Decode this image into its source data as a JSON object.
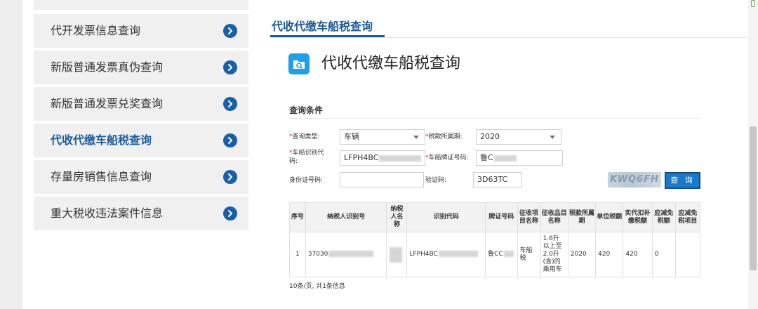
{
  "sidebar": {
    "items": [
      {
        "label": "",
        "active": false
      },
      {
        "label": "代开发票信息查询",
        "active": false
      },
      {
        "label": "新版普通发票真伪查询",
        "active": false
      },
      {
        "label": "新版普通发票兑奖查询",
        "active": false
      },
      {
        "label": "代收代缴车船税查询",
        "active": true
      },
      {
        "label": "存量房销售信息查询",
        "active": false
      },
      {
        "label": "重大税收违法案件信息",
        "active": false
      }
    ]
  },
  "tab": {
    "title": "代收代缴车船税查询"
  },
  "page": {
    "heading": "代收代缴车船税查询",
    "icon": "search-folder-icon"
  },
  "form": {
    "section_label": "查询条件",
    "query_type": {
      "label": "查询类型:",
      "value": "车辆"
    },
    "tax_period": {
      "label": "税款所属期:",
      "value": "2020"
    },
    "vin": {
      "label_line1": "车船识别代",
      "label_line2": "码:",
      "value": "LFPH4BC"
    },
    "plate": {
      "label": "车船牌证号码:",
      "value": "鲁C"
    },
    "id_number": {
      "label": "身份证号码:",
      "value": ""
    },
    "captcha": {
      "label": "验证码:",
      "value": "3D63TC",
      "image_text": "KWQ6FH"
    },
    "query_button": "查 询"
  },
  "table": {
    "headers": [
      "序号",
      "纳税人识别号",
      "纳税人名称",
      "识别代码",
      "牌证号码",
      "征收项目名称",
      "征收品目名称",
      "税款所属期",
      "单位税额",
      "实代扣补缴税额",
      "应减免税额",
      "应减免税项目"
    ],
    "rows": [
      [
        "1",
        "37030",
        "",
        "LFPH4BC",
        "鲁CC",
        "车船税",
        "1.6升以上至2.0升(含)的乘用车",
        "2020",
        "420",
        "420",
        "0",
        ""
      ]
    ]
  },
  "pager": {
    "text": "10条/页, 共1条信息"
  },
  "colors": {
    "accent": "#1e5b9a",
    "chevron": "#1a5fa8",
    "icon_bg": "#1e9fe6",
    "button": "#1e78c8",
    "required": "#e02020"
  }
}
